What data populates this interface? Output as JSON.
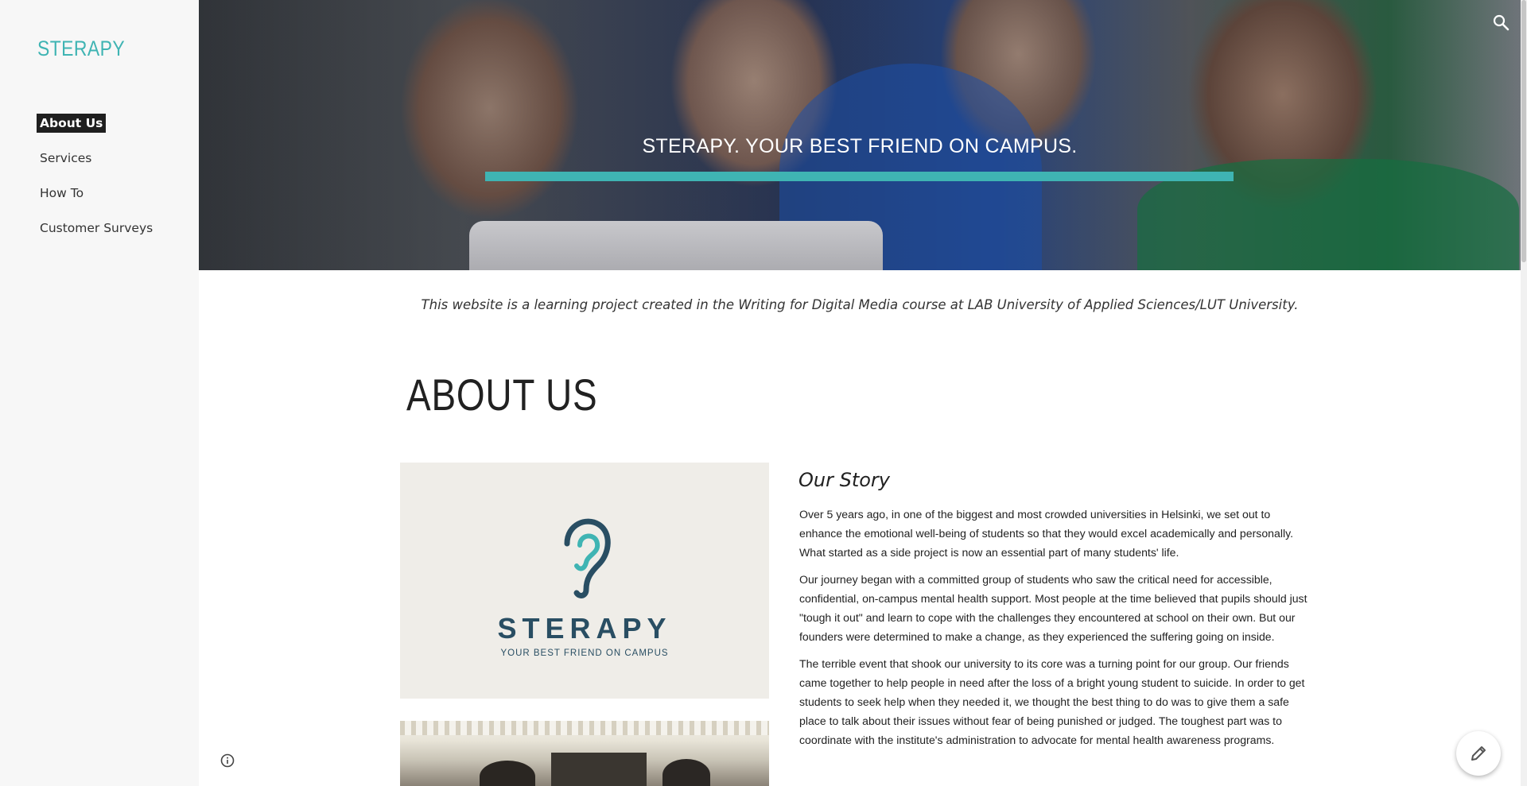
{
  "sidebar": {
    "site_title": "STERAPY",
    "items": [
      {
        "label": "About Us",
        "active": true
      },
      {
        "label": "Services",
        "active": false
      },
      {
        "label": "How To",
        "active": false
      },
      {
        "label": "Customer Surveys",
        "active": false
      }
    ]
  },
  "hero": {
    "title": "STERAPY. YOUR BEST FRIEND ON CAMPUS.",
    "accent_color": "#3fb4b3"
  },
  "disclaimer": "This website is a learning project created in the Writing for Digital Media course at LAB University of Applied Sciences/LUT University.",
  "main": {
    "heading": "ABOUT US",
    "logo": {
      "wordmark": "STERAPY",
      "tagline": "YOUR BEST FRIEND ON CAMPUS"
    },
    "story": {
      "heading": "Our Story",
      "paragraphs": [
        "Over 5 years ago, in one of the biggest and most crowded universities in Helsinki, we set out to enhance the emotional well-being of students so that they would excel academically and personally. What started as a side project is now an essential part of many students' life.",
        "Our journey began with a committed group of students who saw the critical need for accessible, confidential, on-campus mental health support. Most people at the time believed that pupils should just \"tough it out\" and learn to cope with the challenges they encountered at school on their own. But our founders were determined to make a change, as they experienced the suffering going on inside.",
        "The terrible event that shook our university to its core was a turning point for our group. Our friends came together to help people in need after the loss of a bright young student to suicide. In order to get students to seek help when they needed it, we thought the best thing to do was to give them a safe place to talk about their issues without fear of being punished or judged. The toughest part was to coordinate with the institute's administration to advocate for mental health awareness programs."
      ]
    }
  },
  "icons": {
    "search": "search-icon",
    "info": "info-icon",
    "edit": "pencil-icon"
  }
}
